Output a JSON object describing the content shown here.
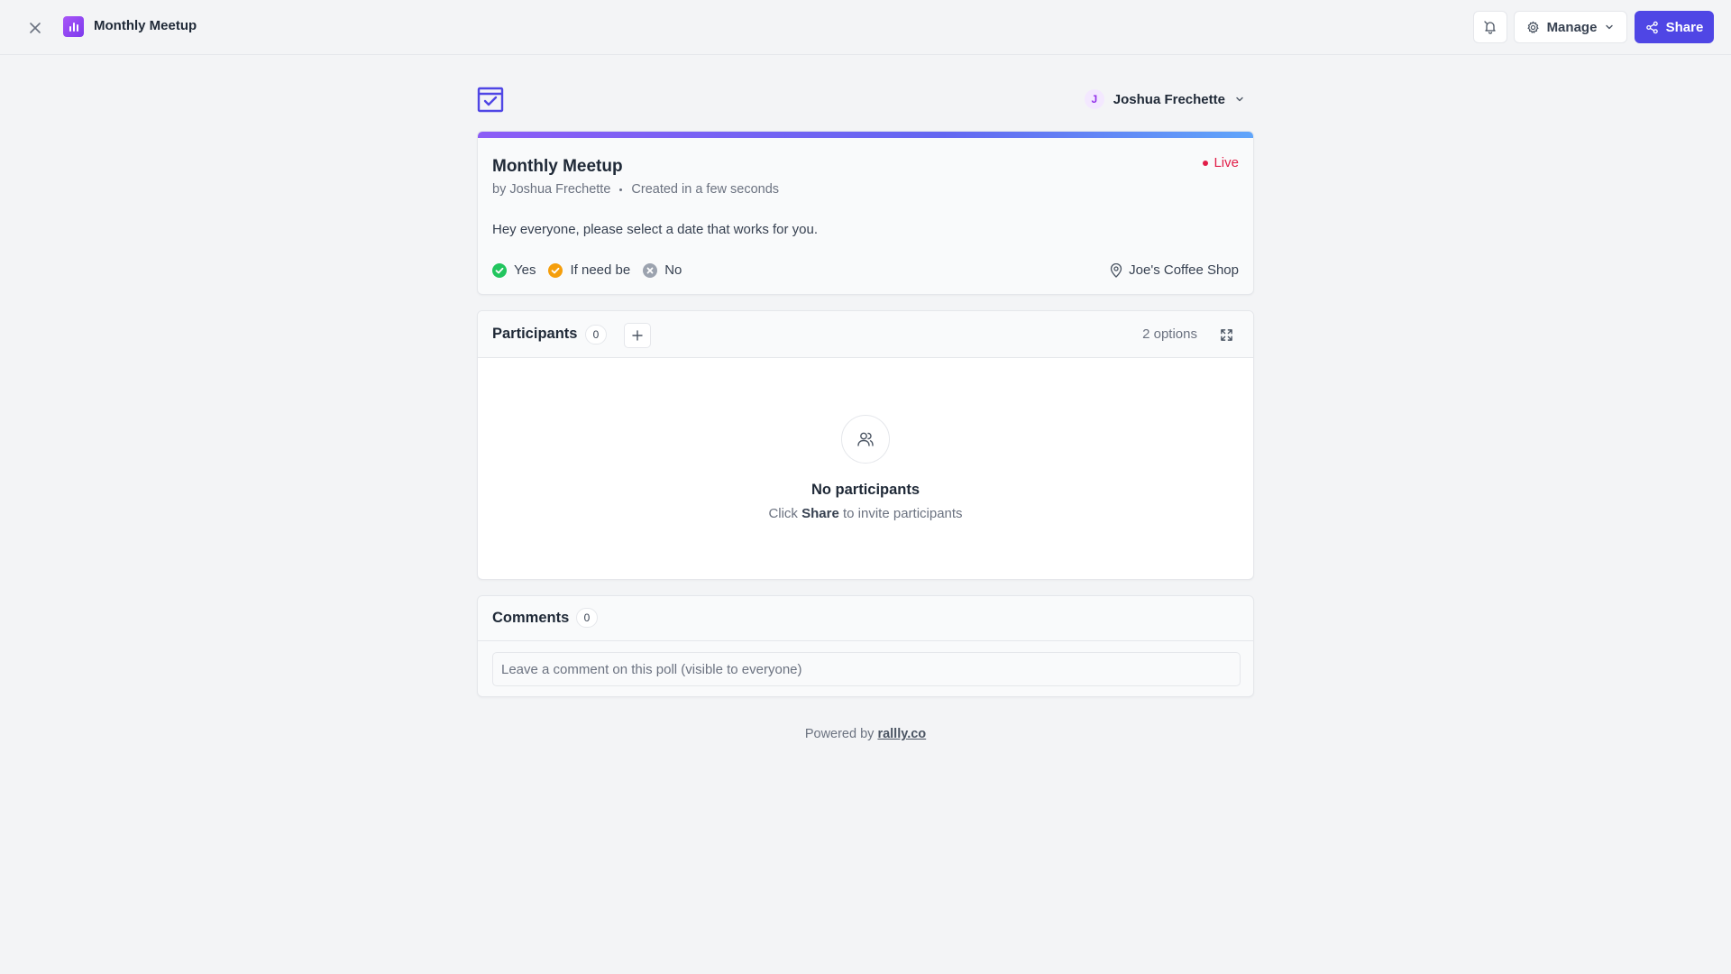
{
  "topbar": {
    "title": "Monthly Meetup",
    "manage_label": "Manage",
    "share_label": "Share"
  },
  "user": {
    "initial": "J",
    "name": "Joshua Frechette"
  },
  "poll": {
    "title": "Monthly Meetup",
    "status": "Live",
    "author": "by Joshua Frechette",
    "created": "Created in a few seconds",
    "description": "Hey everyone, please select a date that works for you.",
    "legend": {
      "yes": "Yes",
      "if_need_be": "If need be",
      "no": "No"
    },
    "location": "Joe's Coffee Shop"
  },
  "participants": {
    "title": "Participants",
    "count": "0",
    "options": "2 options",
    "empty_title": "No participants",
    "empty_pre": "Click",
    "empty_bold": "Share",
    "empty_post": "to invite participants"
  },
  "comments": {
    "title": "Comments",
    "count": "0",
    "placeholder": "Leave a comment on this poll (visible to everyone)"
  },
  "footer": {
    "powered_by": "Powered by",
    "link": "rallly.co"
  },
  "colors": {
    "accent": "#4f46e5",
    "live": "#e11d48",
    "yes": "#22c55e",
    "if_need_be": "#f59e0b",
    "no": "#9ca3af"
  }
}
